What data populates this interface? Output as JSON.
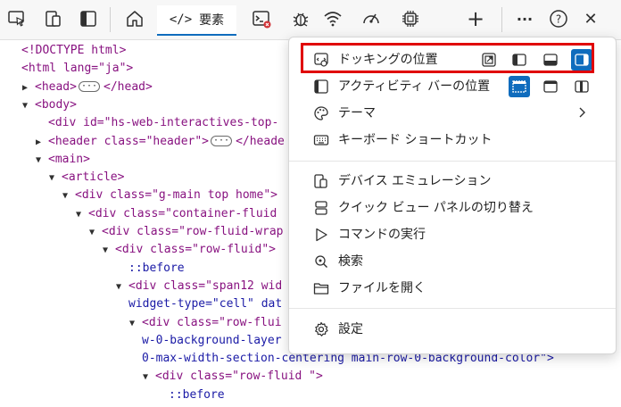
{
  "toolbar": {
    "elements_tab_label": "要素",
    "elements_tab_code": "</>",
    "active_color": "#0f6cbd",
    "error_badge_color": "#d13438",
    "more_label": "···",
    "help_label": "?",
    "close_label": "✕",
    "add_label": "+"
  },
  "dom": {
    "lines": [
      {
        "indent": 0,
        "tri": "",
        "html": "<!DOCTYPE html>"
      },
      {
        "indent": 0,
        "tri": "",
        "html": "<html lang=\"ja\">"
      },
      {
        "indent": 1,
        "tri": "▶",
        "html": "<head>"
      },
      {
        "indent": 1,
        "tri": "▼",
        "html": "<body>"
      },
      {
        "indent": 2,
        "tri": "",
        "html": "<div id=\"hs-web-interactives-top-"
      },
      {
        "indent": 2,
        "tri": "▶",
        "html": "<header class=\"header\">"
      },
      {
        "indent": 2,
        "tri": "▼",
        "html": "<main>"
      },
      {
        "indent": 3,
        "tri": "▼",
        "html": "<article>"
      },
      {
        "indent": 4,
        "tri": "▼",
        "html": "<div class=\"g-main top home\">"
      },
      {
        "indent": 5,
        "tri": "▼",
        "html": "<div class=\"container-fluid"
      },
      {
        "indent": 6,
        "tri": "▼",
        "html": "<div class=\"row-fluid-wrap"
      },
      {
        "indent": 7,
        "tri": "▼",
        "html": "<div class=\"row-fluid\">"
      },
      {
        "indent": 8,
        "tri": "",
        "html": "::before"
      },
      {
        "indent": 8,
        "tri": "▼",
        "html": "<div class=\"span12 wid"
      },
      {
        "indent": 8,
        "tri": "",
        "html": "widget-type=\"cell\" dat"
      },
      {
        "indent": 9,
        "tri": "▼",
        "html": "<div class=\"row-flui"
      },
      {
        "indent": 9,
        "tri": "",
        "html": "w-0-background-layer"
      },
      {
        "indent": 9,
        "tri": "",
        "html": "0-max-width-section-centering main-row-0-background-color\">"
      },
      {
        "indent": 10,
        "tri": "▼",
        "html": "<div class=\"row-fluid \">"
      },
      {
        "indent": 11,
        "tri": "",
        "html": "::before"
      }
    ],
    "head_close": "</head>",
    "header_close": "</heade",
    "ellipsis": "···"
  },
  "menu": {
    "dock_label": "ドッキングの位置",
    "activity_bar_label": "アクティビティ バーの位置",
    "theme_label": "テーマ",
    "shortcuts_label": "キーボード ショートカット",
    "device_emulation_label": "デバイス エミュレーション",
    "quick_view_label": "クイック ビュー パネルの切り替え",
    "run_command_label": "コマンドの実行",
    "search_label": "検索",
    "open_file_label": "ファイルを開く",
    "settings_label": "設定",
    "highlight_color": "#e00000"
  }
}
